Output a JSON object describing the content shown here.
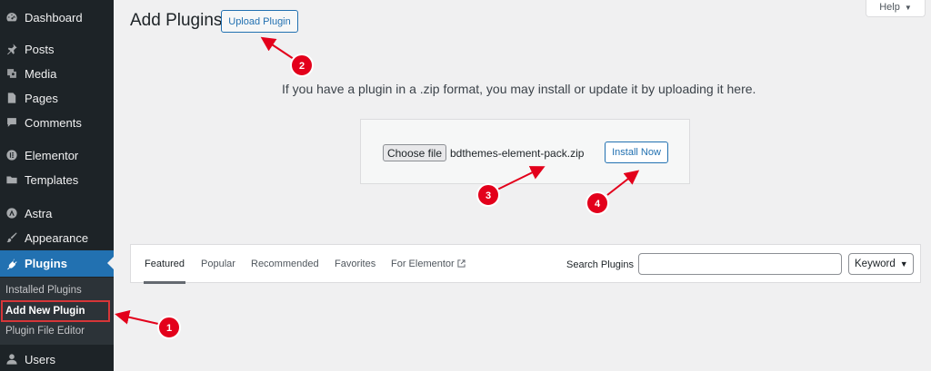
{
  "sidebar": {
    "items": [
      {
        "label": "Dashboard",
        "icon": "dashboard-icon"
      },
      {
        "label": "Posts",
        "icon": "pin-icon"
      },
      {
        "label": "Media",
        "icon": "media-icon"
      },
      {
        "label": "Pages",
        "icon": "page-icon"
      },
      {
        "label": "Comments",
        "icon": "comment-icon"
      },
      {
        "label": "Elementor",
        "icon": "elementor-icon"
      },
      {
        "label": "Templates",
        "icon": "folder-icon"
      },
      {
        "label": "Astra",
        "icon": "astra-icon"
      },
      {
        "label": "Appearance",
        "icon": "brush-icon"
      },
      {
        "label": "Plugins",
        "icon": "plug-icon"
      },
      {
        "label": "Users",
        "icon": "user-icon"
      }
    ],
    "active": "Plugins",
    "submenu": [
      "Installed Plugins",
      "Add New Plugin",
      "Plugin File Editor"
    ],
    "submenu_current": "Add New Plugin"
  },
  "header": {
    "title": "Add Plugins",
    "upload_button": "Upload Plugin",
    "help_button": "Help"
  },
  "upload": {
    "hint": "If you have a plugin in a .zip format, you may install or update it by uploading it here.",
    "choose_file_button": "Choose file",
    "file_name": "bdthemes-element-pack.zip",
    "install_button": "Install Now"
  },
  "filter": {
    "tabs": [
      "Featured",
      "Popular",
      "Recommended",
      "Favorites",
      "For Elementor"
    ],
    "current_tab": "Featured",
    "search_label": "Search Plugins",
    "search_value": "",
    "search_type": "Keyword"
  },
  "annotations": {
    "steps": [
      "1",
      "2",
      "3",
      "4"
    ],
    "color": "#e3001b"
  },
  "colors": {
    "sidebar_bg": "#1d2327",
    "accent": "#2271b1",
    "page_bg": "#f0f0f1"
  }
}
